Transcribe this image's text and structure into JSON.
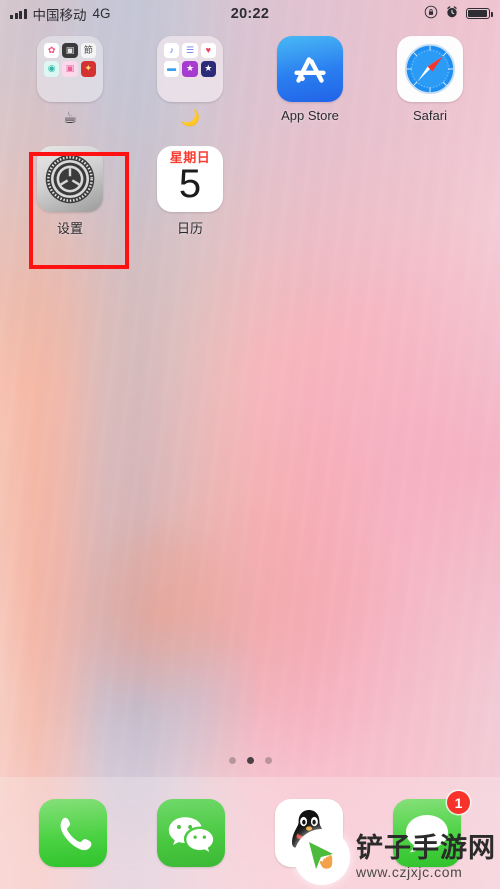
{
  "status_bar": {
    "signal_icon": "signal-bars-icon",
    "carrier": "中国移动",
    "network": "4G",
    "time": "20:22",
    "rotation_lock_icon": "rotation-lock-icon",
    "alarm_icon": "alarm-clock-icon",
    "battery_icon": "battery-icon"
  },
  "home_screen": {
    "rows": [
      {
        "apps": [
          {
            "name": "folder-1",
            "label": "☕",
            "type": "folder",
            "mini_icons": [
              {
                "name": "photos-icon",
                "glyph": "✿",
                "bg": "#ffffff",
                "fg": "#f2517c"
              },
              {
                "name": "camera-icon",
                "glyph": "▣",
                "bg": "#3a3a3c",
                "fg": "#e7e7e7"
              },
              {
                "name": "chinese-app-icon",
                "glyph": "節",
                "bg": "#f4f4f4",
                "fg": "#4a4a4a"
              },
              {
                "name": "teal-app-icon",
                "glyph": "◉",
                "bg": "#ddf7f3",
                "fg": "#34b6a8"
              },
              {
                "name": "pink-camera-icon",
                "glyph": "▣",
                "bg": "#fbd9ea",
                "fg": "#e8629c"
              },
              {
                "name": "red-media-icon",
                "glyph": "✦",
                "bg": "#d43232",
                "fg": "#ffe27a"
              }
            ]
          },
          {
            "name": "folder-2",
            "label": "🌙",
            "type": "folder",
            "mini_icons": [
              {
                "name": "music-icon",
                "glyph": "♪",
                "bg": "#ffffff",
                "fg": "#5b6fe0"
              },
              {
                "name": "reminders-icon",
                "glyph": "☰",
                "bg": "#ffffff",
                "fg": "#6f7df0"
              },
              {
                "name": "health-icon",
                "glyph": "♥",
                "bg": "#ffffff",
                "fg": "#f33b5e"
              },
              {
                "name": "files-icon",
                "glyph": "▬",
                "bg": "#ffffff",
                "fg": "#3aa0f0"
              },
              {
                "name": "itunes-store-icon",
                "glyph": "★",
                "bg": "#a63bd0",
                "fg": "#ffffff"
              },
              {
                "name": "imovie-icon",
                "glyph": "★",
                "bg": "#2b2b7a",
                "fg": "#ffffff"
              }
            ]
          },
          {
            "name": "app-store",
            "label": "App Store",
            "type": "appstore"
          },
          {
            "name": "safari",
            "label": "Safari",
            "type": "safari"
          }
        ]
      },
      {
        "apps": [
          {
            "name": "settings",
            "label": "设置",
            "type": "settings",
            "highlighted": true
          },
          {
            "name": "calendar",
            "label": "日历",
            "type": "calendar",
            "day_of_week": "星期日",
            "day_number": "5"
          }
        ]
      }
    ],
    "highlight_color": "#ff1111"
  },
  "page_indicator": {
    "total": 3,
    "active_index": 1
  },
  "dock": {
    "apps": [
      {
        "name": "phone",
        "type": "phoneapp",
        "icon": "phone-handset-icon",
        "badge": ""
      },
      {
        "name": "wechat",
        "type": "wechat",
        "icon": "wechat-bubbles-icon",
        "badge": ""
      },
      {
        "name": "qq",
        "type": "qq",
        "icon": "qq-penguin-icon",
        "badge": ""
      },
      {
        "name": "messages",
        "type": "messages",
        "icon": "message-bubble-icon",
        "badge": "1"
      }
    ]
  },
  "watermark": {
    "logo_icon": "cursor-arrow-icon",
    "title": "铲子手游网",
    "url": "www.czjxjc.com"
  }
}
